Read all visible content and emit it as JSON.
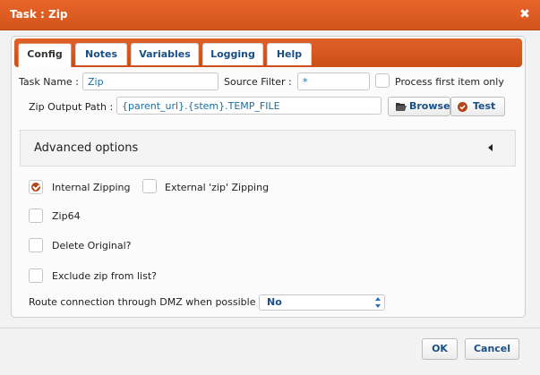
{
  "dialog": {
    "title": "Task : Zip"
  },
  "tabs": [
    "Config",
    "Notes",
    "Variables",
    "Logging",
    "Help"
  ],
  "config": {
    "task_name_label": "Task Name :",
    "task_name_value": "Zip",
    "source_filter_label": "Source Filter :",
    "source_filter_value": "*",
    "process_first_label": "Process first item only",
    "process_first_checked": false,
    "zip_output_label": "Zip Output Path :",
    "zip_output_value": "{parent_url}.{stem}.TEMP_FILE",
    "browse_label": "Browse",
    "test_label": "Test"
  },
  "advanced": {
    "title": "Advanced options",
    "internal_zipping_label": "Internal Zipping",
    "internal_zipping_checked": true,
    "external_zipping_label": "External 'zip' Zipping",
    "external_zipping_checked": false,
    "zip64_label": "Zip64",
    "zip64_checked": false,
    "delete_original_label": "Delete Original?",
    "delete_original_checked": false,
    "exclude_label": "Exclude zip from list?",
    "exclude_checked": false,
    "dmz_label": "Route connection through DMZ when possible :",
    "dmz_value": "No"
  },
  "footer": {
    "ok_label": "OK",
    "cancel_label": "Cancel"
  },
  "colors": {
    "accent": "#d2541b",
    "link": "#1a4f86",
    "check": "#b0471a"
  },
  "icons": {
    "close": "close-icon",
    "browse": "folder-open-icon",
    "test": "check-circle-icon",
    "collapse": "caret-left-icon",
    "select": "updown-arrows-icon"
  }
}
